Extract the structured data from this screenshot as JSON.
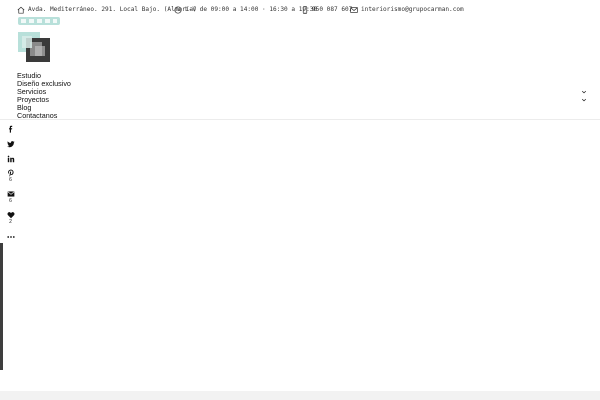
{
  "topbar": {
    "address": "Avda. Mediterráneo. 291. Local Bajo. (Almería)",
    "hours": "L-V de 09:00 a 14:00 · 16:30 a 19:30",
    "phone": "950 087 607",
    "email": "interiorismo@grupocarman.com"
  },
  "icons": {
    "address": "home-icon",
    "hours": "clock-icon",
    "phone": "phone-icon",
    "email": "mail-icon"
  },
  "nav": {
    "items": [
      {
        "label": "Estudio",
        "has_submenu": false
      },
      {
        "label": "Diseño exclusivo",
        "has_submenu": false
      },
      {
        "label": "Servicios",
        "has_submenu": true
      },
      {
        "label": "Proyectos",
        "has_submenu": true
      },
      {
        "label": "Blog",
        "has_submenu": false
      },
      {
        "label": "Contactanos",
        "has_submenu": false
      }
    ]
  },
  "share": {
    "facebook": {
      "icon": "facebook-icon"
    },
    "twitter": {
      "icon": "twitter-icon"
    },
    "linkedin": {
      "icon": "linkedin-icon"
    },
    "pinterest": {
      "icon": "pinterest-icon",
      "count": "6"
    },
    "email": {
      "icon": "mail-icon",
      "count": "6"
    },
    "like": {
      "icon": "heart-icon",
      "count": "2"
    },
    "more": {
      "icon": "more-icon"
    }
  },
  "colors": {
    "accent_mint": "#b8e0da",
    "logo_dark": "#3a3a3a",
    "text": "#111111"
  }
}
